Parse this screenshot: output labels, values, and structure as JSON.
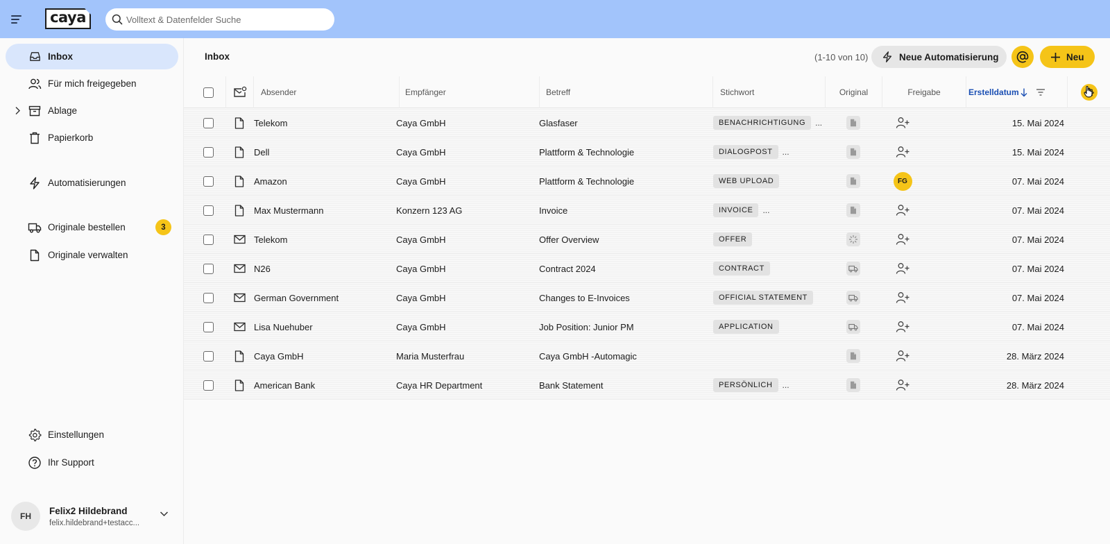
{
  "header": {
    "logo_text": "caya",
    "search_placeholder": "Volltext & Datenfelder Suche"
  },
  "sidebar": {
    "items": [
      {
        "label": "Inbox",
        "icon": "inbox-icon",
        "active": true
      },
      {
        "label": "Für mich freigegeben",
        "icon": "users-icon"
      },
      {
        "label": "Ablage",
        "icon": "archive-icon"
      },
      {
        "label": "Papierkorb",
        "icon": "trash-icon"
      },
      {
        "label": "Automatisierungen",
        "icon": "bolt-icon"
      },
      {
        "label": "Originale bestellen",
        "icon": "truck-icon",
        "badge": "3"
      },
      {
        "label": "Originale verwalten",
        "icon": "document-icon"
      },
      {
        "label": "Einstellungen",
        "icon": "gear-icon"
      },
      {
        "label": "Ihr Support",
        "icon": "help-icon"
      }
    ],
    "user": {
      "initials": "FH",
      "name": "Felix2 Hildebrand",
      "email": "felix.hildebrand+testacc..."
    }
  },
  "main": {
    "title": "Inbox",
    "count": "(1-10 von 10)",
    "automation_button": "Neue Automatisierung",
    "new_button": "Neu",
    "columns": {
      "absender": "Absender",
      "empfaenger": "Empfänger",
      "betreff": "Betreff",
      "stichwort": "Stichwort",
      "original": "Original",
      "freigabe": "Freigabe",
      "erstelldatum": "Erstelldatum"
    },
    "rows": [
      {
        "type": "document",
        "sender": "Telekom",
        "recipient": "Caya GmbH",
        "subject": "Glasfaser",
        "tag": "BENACHRICHTIGUNG",
        "more": "...",
        "original": "document",
        "share": "add-user",
        "date": "15. Mai 2024"
      },
      {
        "type": "document",
        "sender": "Dell",
        "recipient": "Caya GmbH",
        "subject": "Plattform & Technologie",
        "tag": "DIALOGPOST",
        "more": "...",
        "original": "document",
        "share": "add-user",
        "date": "15. Mai 2024"
      },
      {
        "type": "document",
        "sender": "Amazon",
        "recipient": "Caya GmbH",
        "subject": "Plattform & Technologie",
        "tag": "WEB UPLOAD",
        "more": "",
        "original": "document",
        "share": "FG",
        "date": "07. Mai 2024"
      },
      {
        "type": "document",
        "sender": "Max Mustermann",
        "recipient": "Konzern 123 AG",
        "subject": "Invoice",
        "tag": "INVOICE",
        "more": "...",
        "original": "document",
        "share": "add-user",
        "date": "07. Mai 2024"
      },
      {
        "type": "mail",
        "sender": "Telekom",
        "recipient": "Caya GmbH",
        "subject": "Offer Overview",
        "tag": "OFFER",
        "more": "",
        "original": "loading",
        "share": "add-user",
        "date": "07. Mai 2024"
      },
      {
        "type": "mail",
        "sender": "N26",
        "recipient": "Caya GmbH",
        "subject": "Contract 2024",
        "tag": "CONTRACT",
        "more": "",
        "original": "truck",
        "share": "add-user",
        "date": "07. Mai 2024"
      },
      {
        "type": "mail",
        "sender": "German Government",
        "recipient": "Caya GmbH",
        "subject": "Changes to E-Invoices",
        "tag": "OFFICIAL STATEMENT",
        "more": "",
        "original": "truck",
        "share": "add-user",
        "date": "07. Mai 2024"
      },
      {
        "type": "mail",
        "sender": "Lisa Nuehuber",
        "recipient": "Caya GmbH",
        "subject": "Job Position: Junior PM",
        "tag": "APPLICATION",
        "more": "",
        "original": "truck",
        "share": "add-user",
        "date": "07. Mai 2024"
      },
      {
        "type": "document",
        "sender": "Caya GmbH",
        "recipient": "Maria Musterfrau",
        "subject": "Caya GmbH -Automagic",
        "tag": "",
        "more": "",
        "original": "document",
        "share": "add-user",
        "date": "28. März 2024"
      },
      {
        "type": "document",
        "sender": "American Bank",
        "recipient": "Caya HR Department",
        "subject": "Bank Statement",
        "tag": "PERSÖNLICH",
        "more": "...",
        "original": "document",
        "share": "add-user",
        "date": "28. März 2024"
      }
    ]
  },
  "colors": {
    "topbar": "#a2c4fb",
    "active_nav": "#d9e6fc",
    "accent_yellow": "#f5c418",
    "sort_blue": "#1b4fb3"
  }
}
